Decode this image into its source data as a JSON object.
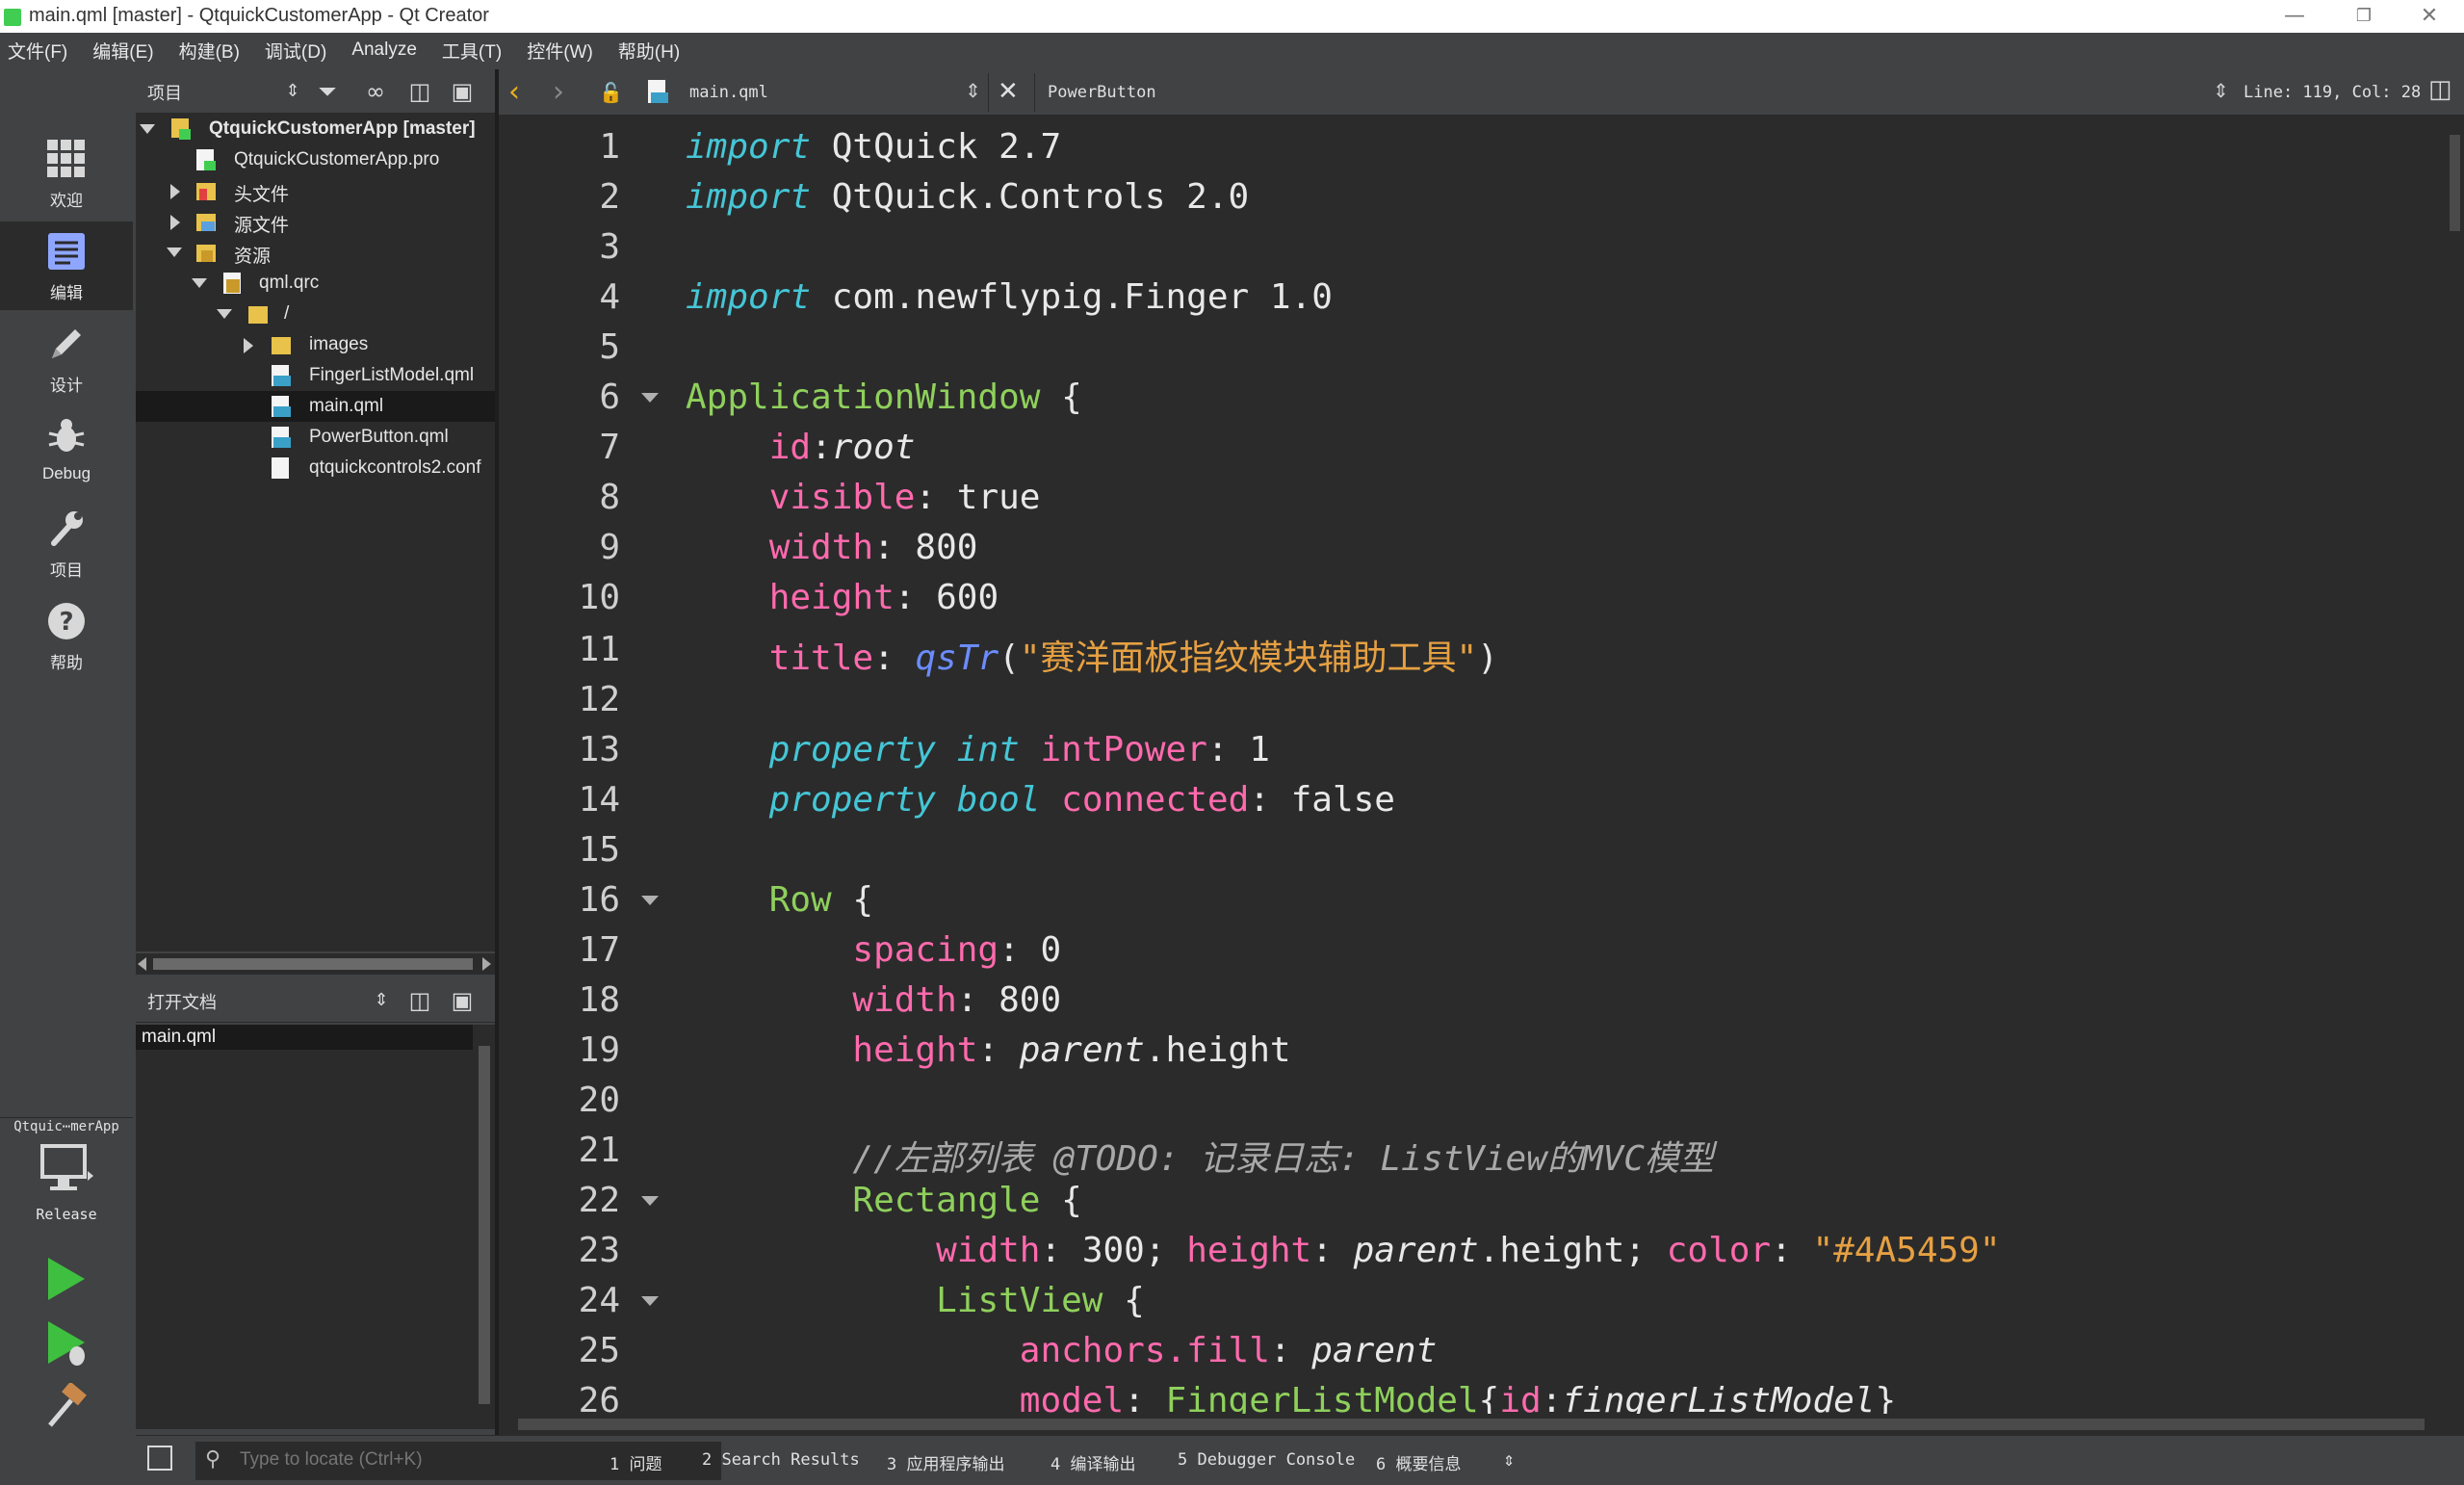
{
  "window": {
    "title": "main.qml [master] - QtquickCustomerApp - Qt Creator"
  },
  "menubar": [
    "文件(F)",
    "编辑(E)",
    "构建(B)",
    "调试(D)",
    "Analyze",
    "工具(T)",
    "控件(W)",
    "帮助(H)"
  ],
  "modes": [
    {
      "label": "欢迎",
      "icon": "grid-icon"
    },
    {
      "label": "编辑",
      "icon": "edit-document-icon",
      "active": true
    },
    {
      "label": "设计",
      "icon": "pencil-icon"
    },
    {
      "label": "Debug",
      "icon": "bug-icon"
    },
    {
      "label": "项目",
      "icon": "wrench-icon"
    },
    {
      "label": "帮助",
      "icon": "help-icon"
    }
  ],
  "kit": {
    "name": "Qtquic⋯merApp",
    "build": "Release"
  },
  "project_panel": {
    "title": "项目",
    "tree": [
      {
        "label": "QtquickCustomerApp [master]",
        "depth": 0,
        "expanded": true,
        "bold": true,
        "icon": "project-icon"
      },
      {
        "label": "QtquickCustomerApp.pro",
        "depth": 1,
        "icon": "pro-file-icon"
      },
      {
        "label": "头文件",
        "depth": 1,
        "expanded": false,
        "icon": "headers-folder-icon"
      },
      {
        "label": "源文件",
        "depth": 1,
        "expanded": false,
        "icon": "sources-folder-icon"
      },
      {
        "label": "资源",
        "depth": 1,
        "expanded": true,
        "icon": "resources-folder-icon"
      },
      {
        "label": "qml.qrc",
        "depth": 2,
        "expanded": true,
        "icon": "qrc-icon"
      },
      {
        "label": "/",
        "depth": 3,
        "expanded": true,
        "icon": "folder-icon"
      },
      {
        "label": "images",
        "depth": 4,
        "expanded": false,
        "icon": "folder-icon"
      },
      {
        "label": "FingerListModel.qml",
        "depth": 4,
        "icon": "qml-file-icon"
      },
      {
        "label": "main.qml",
        "depth": 4,
        "icon": "qml-file-icon",
        "selected": true
      },
      {
        "label": "PowerButton.qml",
        "depth": 4,
        "icon": "qml-file-icon"
      },
      {
        "label": "qtquickcontrols2.conf",
        "depth": 4,
        "icon": "file-icon"
      }
    ]
  },
  "open_docs": {
    "title": "打开文档",
    "items": [
      "main.qml"
    ]
  },
  "editor": {
    "file": "main.qml",
    "symbol": "PowerButton",
    "position": "Line: 119, Col: 28",
    "lines": [
      {
        "n": "1",
        "fold": false,
        "tokens": [
          [
            "kw",
            "import"
          ],
          [
            "plain",
            " QtQuick 2.7"
          ]
        ]
      },
      {
        "n": "2",
        "fold": false,
        "tokens": [
          [
            "kw",
            "import"
          ],
          [
            "plain",
            " QtQuick.Controls 2.0"
          ]
        ]
      },
      {
        "n": "3",
        "fold": false,
        "tokens": []
      },
      {
        "n": "4",
        "fold": false,
        "tokens": [
          [
            "kw",
            "import"
          ],
          [
            "plain",
            " com.newflypig.Finger 1.0"
          ]
        ]
      },
      {
        "n": "5",
        "fold": false,
        "tokens": []
      },
      {
        "n": "6",
        "fold": true,
        "tokens": [
          [
            "qml",
            "ApplicationWindow"
          ],
          [
            "plain",
            " {"
          ]
        ]
      },
      {
        "n": "7",
        "fold": false,
        "tokens": [
          [
            "plain",
            "    "
          ],
          [
            "prop",
            "id"
          ],
          [
            "plain",
            ":"
          ],
          [
            "it",
            "root"
          ]
        ]
      },
      {
        "n": "8",
        "fold": false,
        "tokens": [
          [
            "plain",
            "    "
          ],
          [
            "prop",
            "visible"
          ],
          [
            "plain",
            ": true"
          ]
        ]
      },
      {
        "n": "9",
        "fold": false,
        "tokens": [
          [
            "plain",
            "    "
          ],
          [
            "prop",
            "width"
          ],
          [
            "plain",
            ": 800"
          ]
        ]
      },
      {
        "n": "10",
        "fold": false,
        "tokens": [
          [
            "plain",
            "    "
          ],
          [
            "prop",
            "height"
          ],
          [
            "plain",
            ": 600"
          ]
        ]
      },
      {
        "n": "11",
        "fold": false,
        "tokens": [
          [
            "plain",
            "    "
          ],
          [
            "prop",
            "title"
          ],
          [
            "plain",
            ": "
          ],
          [
            "fn",
            "qsTr"
          ],
          [
            "plain",
            "("
          ],
          [
            "str",
            "\"赛洋面板指纹模块辅助工具\""
          ],
          [
            "plain",
            ")"
          ]
        ]
      },
      {
        "n": "12",
        "fold": false,
        "tokens": []
      },
      {
        "n": "13",
        "fold": false,
        "tokens": [
          [
            "plain",
            "    "
          ],
          [
            "kw",
            "property"
          ],
          [
            "plain",
            " "
          ],
          [
            "kw",
            "int"
          ],
          [
            "plain",
            " "
          ],
          [
            "prop",
            "intPower"
          ],
          [
            "plain",
            ": 1"
          ]
        ]
      },
      {
        "n": "14",
        "fold": false,
        "tokens": [
          [
            "plain",
            "    "
          ],
          [
            "kw",
            "property"
          ],
          [
            "plain",
            " "
          ],
          [
            "kw",
            "bool"
          ],
          [
            "plain",
            " "
          ],
          [
            "prop",
            "connected"
          ],
          [
            "plain",
            ": false"
          ]
        ]
      },
      {
        "n": "15",
        "fold": false,
        "tokens": []
      },
      {
        "n": "16",
        "fold": true,
        "tokens": [
          [
            "plain",
            "    "
          ],
          [
            "qml",
            "Row"
          ],
          [
            "plain",
            " {"
          ]
        ]
      },
      {
        "n": "17",
        "fold": false,
        "tokens": [
          [
            "plain",
            "        "
          ],
          [
            "prop",
            "spacing"
          ],
          [
            "plain",
            ": 0"
          ]
        ]
      },
      {
        "n": "18",
        "fold": false,
        "tokens": [
          [
            "plain",
            "        "
          ],
          [
            "prop",
            "width"
          ],
          [
            "plain",
            ": 800"
          ]
        ]
      },
      {
        "n": "19",
        "fold": false,
        "tokens": [
          [
            "plain",
            "        "
          ],
          [
            "prop",
            "height"
          ],
          [
            "plain",
            ": "
          ],
          [
            "it",
            "parent"
          ],
          [
            "plain",
            ".height"
          ]
        ]
      },
      {
        "n": "20",
        "fold": false,
        "tokens": []
      },
      {
        "n": "21",
        "fold": false,
        "tokens": [
          [
            "plain",
            "        "
          ],
          [
            "cmt",
            "//左部列表 @TODO: 记录日志: ListView的MVC模型"
          ]
        ]
      },
      {
        "n": "22",
        "fold": true,
        "tokens": [
          [
            "plain",
            "        "
          ],
          [
            "qml",
            "Rectangle"
          ],
          [
            "plain",
            " {"
          ]
        ]
      },
      {
        "n": "23",
        "fold": false,
        "tokens": [
          [
            "plain",
            "            "
          ],
          [
            "prop",
            "width"
          ],
          [
            "plain",
            ": 300; "
          ],
          [
            "prop",
            "height"
          ],
          [
            "plain",
            ": "
          ],
          [
            "it",
            "parent"
          ],
          [
            "plain",
            ".height; "
          ],
          [
            "prop",
            "color"
          ],
          [
            "plain",
            ": "
          ],
          [
            "str",
            "\"#4A5459\""
          ]
        ]
      },
      {
        "n": "24",
        "fold": true,
        "tokens": [
          [
            "plain",
            "            "
          ],
          [
            "qml",
            "ListView"
          ],
          [
            "plain",
            " {"
          ]
        ]
      },
      {
        "n": "25",
        "fold": false,
        "tokens": [
          [
            "plain",
            "                "
          ],
          [
            "prop",
            "anchors.fill"
          ],
          [
            "plain",
            ": "
          ],
          [
            "it",
            "parent"
          ]
        ]
      },
      {
        "n": "26",
        "fold": false,
        "tokens": [
          [
            "plain",
            "                "
          ],
          [
            "prop",
            "model"
          ],
          [
            "plain",
            ": "
          ],
          [
            "qml",
            "FingerListModel"
          ],
          [
            "plain",
            "{"
          ],
          [
            "prop",
            "id"
          ],
          [
            "plain",
            ":"
          ],
          [
            "it",
            "fingerListModel"
          ],
          [
            "plain",
            "}"
          ]
        ]
      }
    ]
  },
  "bottombar": {
    "locator_placeholder": "Type to locate (Ctrl+K)",
    "tabs": [
      "1  问题",
      "2  Search Results",
      "3  应用程序输出",
      "4  编译输出",
      "5  Debugger Console",
      "6  概要信息"
    ]
  }
}
